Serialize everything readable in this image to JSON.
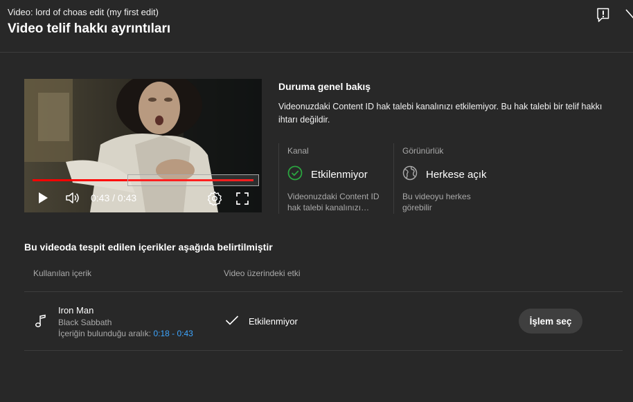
{
  "header": {
    "video_label": "Video: lord of choas edit (my first edit)",
    "title": "Video telif hakkı ayrıntıları",
    "feedback_icon": "report-feedback-icon",
    "close_icon": "close-icon"
  },
  "player": {
    "time": "0:43 / 0:43",
    "progress": 1.0,
    "icons": [
      "play-icon",
      "volume-icon",
      "settings-icon",
      "fullscreen-icon"
    ]
  },
  "overview": {
    "title": "Duruma genel bakış",
    "description": "Videonuzdaki Content ID hak talebi kanalınızı etkilemiyor. Bu hak talebi bir telif hakkı ihtarı değildir.",
    "channel": {
      "heading": "Kanal",
      "status": "Etkilenmiyor",
      "note": "Videonuzdaki Content ID hak talebi kanalınızı…",
      "icon": "check-circle-icon",
      "color": "#2ba640"
    },
    "visibility": {
      "heading": "Görünürlük",
      "status": "Herkese açık",
      "note": "Bu videoyu herkes görebilir",
      "icon": "globe-icon"
    }
  },
  "content": {
    "title": "Bu videoda tespit edilen içerikler aşağıda belirtilmiştir",
    "columns": {
      "used": "Kullanılan içerik",
      "effect": "Video üzerindeki etki"
    },
    "rows": [
      {
        "song": "Iron Man",
        "artist": "Black Sabbath",
        "range_label": "İçeriğin bulunduğu aralık:",
        "range": "0:18 - 0:43",
        "effect": "Etkilenmiyor",
        "action": "İşlem seç",
        "icon": "music-note-icon"
      }
    ]
  },
  "colors": {
    "background": "#282828",
    "link": "#3ea6ff",
    "progress": "#ff0000"
  }
}
